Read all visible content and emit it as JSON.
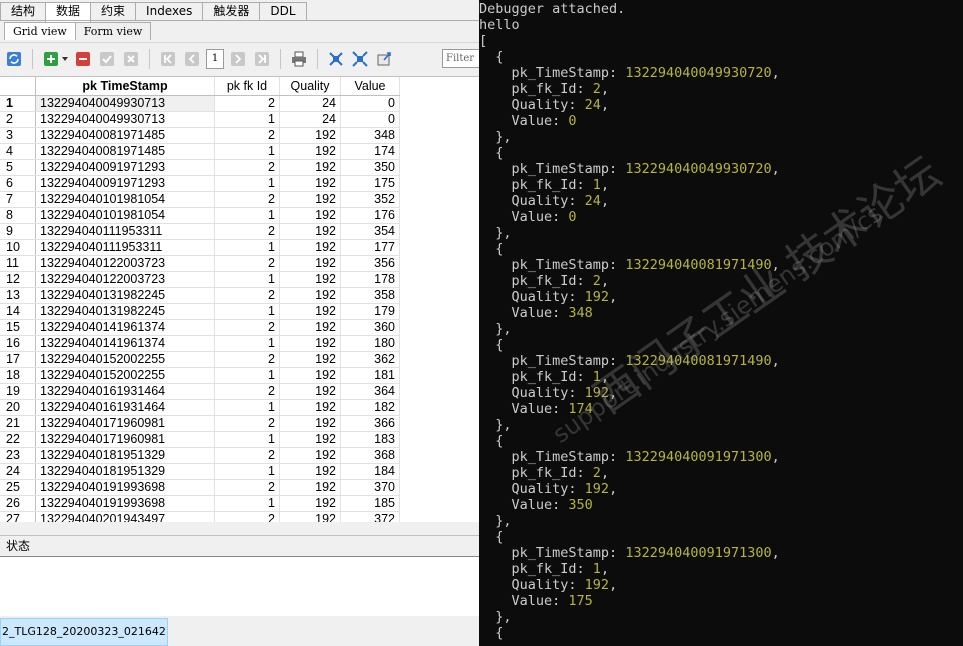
{
  "app": {
    "main_tabs": [
      "结构",
      "数据",
      "约束",
      "Indexes",
      "触发器",
      "DDL"
    ],
    "active_main_tab": "数据",
    "view_tabs": [
      "Grid view",
      "Form view"
    ],
    "active_view_tab": "Grid view",
    "toolbar": {
      "page_number": "1",
      "filter_placeholder": "Filter"
    },
    "grid": {
      "columns": [
        "pk TimeStamp",
        "pk fk Id",
        "Quality",
        "Value"
      ],
      "rows": [
        [
          "1",
          "132294040049930713",
          "2",
          "24",
          "0"
        ],
        [
          "2",
          "132294040049930713",
          "1",
          "24",
          "0"
        ],
        [
          "3",
          "132294040081971485",
          "2",
          "192",
          "348"
        ],
        [
          "4",
          "132294040081971485",
          "1",
          "192",
          "174"
        ],
        [
          "5",
          "132294040091971293",
          "2",
          "192",
          "350"
        ],
        [
          "6",
          "132294040091971293",
          "1",
          "192",
          "175"
        ],
        [
          "7",
          "132294040101981054",
          "2",
          "192",
          "352"
        ],
        [
          "8",
          "132294040101981054",
          "1",
          "192",
          "176"
        ],
        [
          "9",
          "132294040111953311",
          "2",
          "192",
          "354"
        ],
        [
          "10",
          "132294040111953311",
          "1",
          "192",
          "177"
        ],
        [
          "11",
          "132294040122003723",
          "2",
          "192",
          "356"
        ],
        [
          "12",
          "132294040122003723",
          "1",
          "192",
          "178"
        ],
        [
          "13",
          "132294040131982245",
          "2",
          "192",
          "358"
        ],
        [
          "14",
          "132294040131982245",
          "1",
          "192",
          "179"
        ],
        [
          "15",
          "132294040141961374",
          "2",
          "192",
          "360"
        ],
        [
          "16",
          "132294040141961374",
          "1",
          "192",
          "180"
        ],
        [
          "17",
          "132294040152002255",
          "2",
          "192",
          "362"
        ],
        [
          "18",
          "132294040152002255",
          "1",
          "192",
          "181"
        ],
        [
          "19",
          "132294040161931464",
          "2",
          "192",
          "364"
        ],
        [
          "20",
          "132294040161931464",
          "1",
          "192",
          "182"
        ],
        [
          "21",
          "132294040171960981",
          "2",
          "192",
          "366"
        ],
        [
          "22",
          "132294040171960981",
          "1",
          "192",
          "183"
        ],
        [
          "23",
          "132294040181951329",
          "2",
          "192",
          "368"
        ],
        [
          "24",
          "132294040181951329",
          "1",
          "192",
          "184"
        ],
        [
          "25",
          "132294040191993698",
          "2",
          "192",
          "370"
        ],
        [
          "26",
          "132294040191993698",
          "1",
          "192",
          "185"
        ],
        [
          "27",
          "132294040201943497",
          "2",
          "192",
          "372"
        ]
      ]
    },
    "status_label": "状态",
    "taskbar_item": "2_TLG128_20200323_021642)"
  },
  "console": {
    "lines": [
      {
        "t": "Debugger attached."
      },
      {
        "t": "hello"
      },
      {
        "t": "["
      },
      {
        "t": "  {"
      },
      {
        "k": "    pk_TimeStamp: ",
        "v": "132294040049930720",
        "e": ","
      },
      {
        "k": "    pk_fk_Id: ",
        "v": "2",
        "e": ","
      },
      {
        "k": "    Quality: ",
        "v": "24",
        "e": ","
      },
      {
        "k": "    Value: ",
        "v": "0",
        "e": ""
      },
      {
        "t": "  },"
      },
      {
        "t": "  {"
      },
      {
        "k": "    pk_TimeStamp: ",
        "v": "132294040049930720",
        "e": ","
      },
      {
        "k": "    pk_fk_Id: ",
        "v": "1",
        "e": ","
      },
      {
        "k": "    Quality: ",
        "v": "24",
        "e": ","
      },
      {
        "k": "    Value: ",
        "v": "0",
        "e": ""
      },
      {
        "t": "  },"
      },
      {
        "t": "  {"
      },
      {
        "k": "    pk_TimeStamp: ",
        "v": "132294040081971490",
        "e": ","
      },
      {
        "k": "    pk_fk_Id: ",
        "v": "2",
        "e": ","
      },
      {
        "k": "    Quality: ",
        "v": "192",
        "e": ","
      },
      {
        "k": "    Value: ",
        "v": "348",
        "e": ""
      },
      {
        "t": "  },"
      },
      {
        "t": "  {"
      },
      {
        "k": "    pk_TimeStamp: ",
        "v": "132294040081971490",
        "e": ","
      },
      {
        "k": "    pk_fk_Id: ",
        "v": "1",
        "e": ","
      },
      {
        "k": "    Quality: ",
        "v": "192",
        "e": ","
      },
      {
        "k": "    Value: ",
        "v": "174",
        "e": ""
      },
      {
        "t": "  },"
      },
      {
        "t": "  {"
      },
      {
        "k": "    pk_TimeStamp: ",
        "v": "132294040091971300",
        "e": ","
      },
      {
        "k": "    pk_fk_Id: ",
        "v": "2",
        "e": ","
      },
      {
        "k": "    Quality: ",
        "v": "192",
        "e": ","
      },
      {
        "k": "    Value: ",
        "v": "350",
        "e": ""
      },
      {
        "t": "  },"
      },
      {
        "t": "  {"
      },
      {
        "k": "    pk_TimeStamp: ",
        "v": "132294040091971300",
        "e": ","
      },
      {
        "k": "    pk_fk_Id: ",
        "v": "1",
        "e": ","
      },
      {
        "k": "    Quality: ",
        "v": "192",
        "e": ","
      },
      {
        "k": "    Value: ",
        "v": "175",
        "e": ""
      },
      {
        "t": "  },"
      },
      {
        "t": "  {"
      }
    ]
  },
  "watermark": {
    "cn": "西门子工业 技术论坛",
    "url": "support.industry.siemens.com/cs"
  },
  "colors": {
    "console_bg": "#0c0c0c",
    "console_text": "#cccccc",
    "console_value": "#b5b53c",
    "selection": "#cce8ff"
  }
}
